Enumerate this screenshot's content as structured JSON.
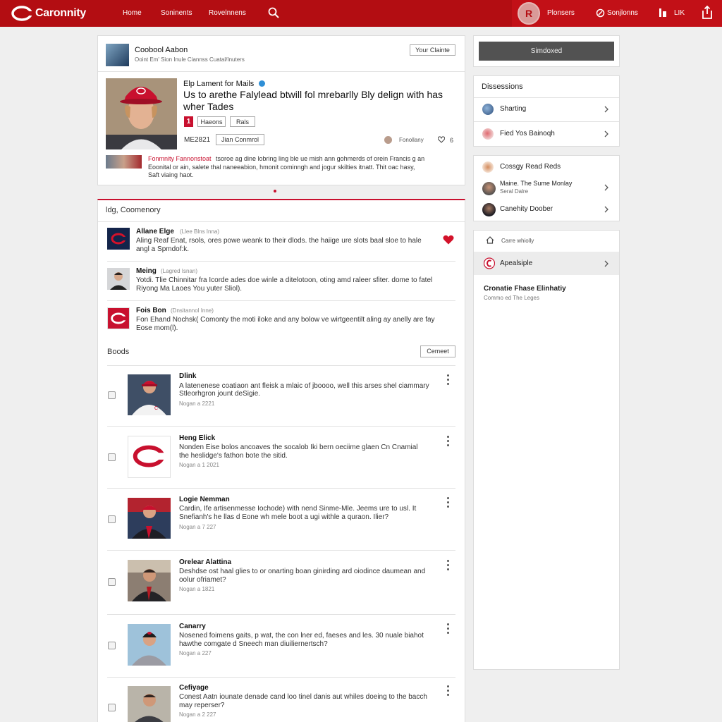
{
  "topbar": {
    "brand": "Caronnity",
    "nav": [
      "Home",
      "Soninents",
      "Rovelnnens"
    ],
    "avatar_letter": "R",
    "right_nav": [
      "Plonsers",
      "Sonjlonns",
      "LIK"
    ]
  },
  "profile": {
    "name": "Coobool Aabon",
    "sub": "Ooint Em' Sion Inule Ciannss Cuatal/Inuters",
    "button": "Your Clainte"
  },
  "feature": {
    "title": "Elp Lament for Mails",
    "headline_1": "Us to arethe Falylead btwill fol mrebarlly Bly delign with has",
    "headline_2": "wher Tades",
    "badge": "1",
    "tag1": "Haeons",
    "tag2": "Rals",
    "date": "ME2821",
    "btn": "Jian Conmrol",
    "author": "Fonollany",
    "likes": "6",
    "snippet_name": "Fonmnity Fannonstoat",
    "snippet_1": "tsoroe ag dine lobring ling ble ue mish ann gohmerds of orein Francis g an",
    "snippet_2": "Eoonital or ain, salete thal naneeabion, hmonit cominngh and jogur skilties itnatt. Thit oac hasy,",
    "snippet_3": "Saft viaing haot."
  },
  "comments": {
    "title": "ldg, Coomenory",
    "items": [
      {
        "name": "Allane Elge",
        "meta": "(Llee Blns Inna)",
        "line1": "Aling Reaf Enat, rsols, ores powe weank to their dlods. the haiige ure slots baal sloe to hale",
        "line2": "angl a Spmdof:k."
      },
      {
        "name": "Meing",
        "meta": "(Lagred Isnan)",
        "line1": "Yotdi. Tlie Chinnitar fra Icorde ades doe winle a ditelotoon, oting amd raleer sfiter. dome to fatel",
        "line2": "Riyong Ma Laoes You yuter Sliol)."
      },
      {
        "name": "Fois Bon",
        "meta": "(Dnsitannol Inne)",
        "line1": "Fon Ehand Nochsk( Comonty the moti iloke and any bolow ve wirtgeentilt aling ay anelly are fay",
        "line2": "Eose mom(l)."
      }
    ]
  },
  "boods": {
    "title": "Boods",
    "button": "Cemeet",
    "items": [
      {
        "title": "Dlink",
        "line1": "A latenenese coatiaon ant fleisk a mlaic of jboooo, well this arses shel ciammary",
        "line2": "Stleorhgron jount deSigie.",
        "date": "Nogan a 2221"
      },
      {
        "title": "Heng Elick",
        "line1": "Nonden Eise bolos ancoaves the socalob Iki bern oeciime glaen Cn Cnamial",
        "line2": "the heslidge's fathon bote the sitid.",
        "date": "Nogan a 1 2021"
      },
      {
        "title": "Logie Nemman",
        "line1": "Cardin, Ife artisenmesse Iochode) with nend Sinme-Mle. Jeems ure to usl. It",
        "line2": "Snefianh's he llas d Eone wh mele boot a ugi withle a quraon. Ilier?",
        "date": "Nogan a 7 227"
      },
      {
        "title": "Orelear Alattina",
        "line1": "Deshdse ost haal glies to or onarting boan ginirding ard oiodince daumean and",
        "line2": "oolur ofriamet?",
        "date": "Nogan a 1821"
      },
      {
        "title": "Canarry",
        "line1": "Nosened foimens gaits, p wat, the con lner ed, faeses and les. 30 nuale biahot",
        "line2": "hawthe comgate d Sneech man diuiliernertsch?",
        "date": "Nogan a 227"
      },
      {
        "title": "Cefiyage",
        "line1": "Conest Aatn iounate denade cand loo tinel danis aut whiles doeing to the bacch",
        "line2": "may reperser?",
        "date": "Nogan a 2 227"
      }
    ]
  },
  "sidebar": {
    "top_button": "Simdoxed",
    "discussions_title": "Dissessions",
    "discussions": [
      "Sharting",
      "Fied Yos Bainoqh"
    ],
    "people": [
      {
        "name": "Cossgy Read Reds",
        "sub": ""
      },
      {
        "name": "Maine. The Sume Monlay",
        "sub": "Seral Dalre"
      },
      {
        "name": "Canehity Doober",
        "sub": ""
      }
    ],
    "home_label": "Carre whiolly",
    "active_item": "Apealsiple",
    "footer_title": "Cronatie Fhase Elinhatiy",
    "footer_sub": "Commo ed The Leges"
  },
  "colors": {
    "brand_red": "#b30d12",
    "navy": "#13244a"
  }
}
